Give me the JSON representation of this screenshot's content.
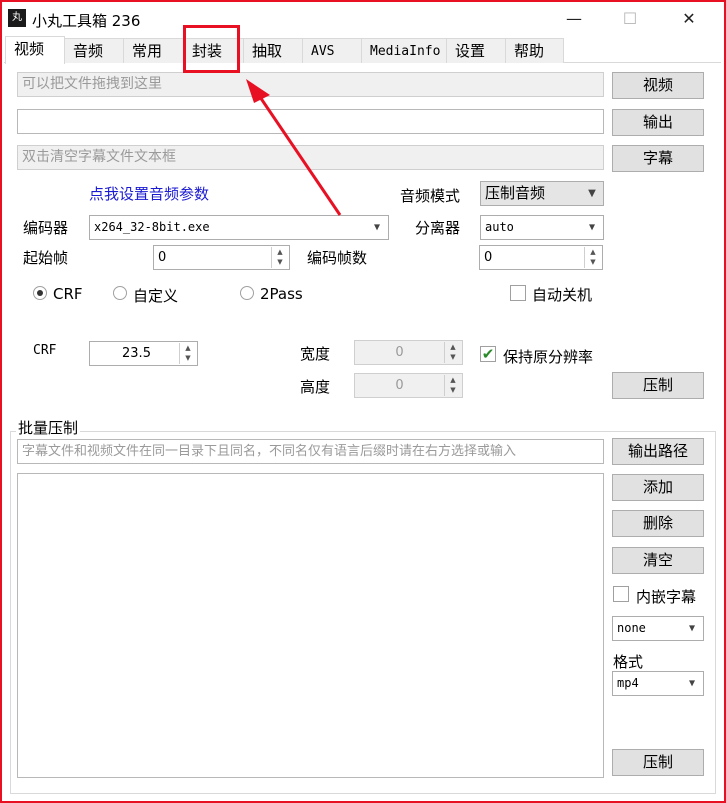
{
  "window": {
    "title": "小丸工具箱 236",
    "app_icon_text": "丸",
    "minimize": "—",
    "maximize": "☐",
    "close": "✕"
  },
  "tabs": [
    "视频",
    "音频",
    "常用",
    "封装",
    "抽取",
    "AVS",
    "MediaInfo",
    "设置",
    "帮助"
  ],
  "video": {
    "drop_placeholder": "可以把文件拖拽到这里",
    "output_value": "",
    "subtitle_placeholder": "双击清空字幕文件文本框",
    "btn_video": "视频",
    "btn_output": "输出",
    "btn_subtitle": "字幕",
    "audio_settings_link": "点我设置音频参数",
    "audio_mode_label": "音频模式",
    "audio_mode_value": "压制音频",
    "encoder_label": "编码器",
    "encoder_value": "x264_32-8bit.exe",
    "demuxer_label": "分离器",
    "demuxer_value": "auto",
    "start_frame_label": "起始帧",
    "start_frame_value": "0",
    "encode_frames_label": "编码帧数",
    "encode_frames_value": "0",
    "mode_crf": "CRF",
    "mode_custom": "自定义",
    "mode_2pass": "2Pass",
    "selected_mode": "CRF",
    "auto_shutdown_label": "自动关机",
    "auto_shutdown_checked": false,
    "crf_label": "CRF",
    "crf_value": "23.5",
    "width_label": "宽度",
    "width_value": "0",
    "height_label": "高度",
    "height_value": "0",
    "keep_res_label": "保持原分辨率",
    "keep_res_checked": true,
    "btn_encode": "压制"
  },
  "batch": {
    "group_title": "批量压制",
    "hint_placeholder": "字幕文件和视频文件在同一目录下且同名，不同名仅有语言后缀时请在右方选择或输入",
    "btn_output_path": "输出路径",
    "btn_add": "添加",
    "btn_delete": "删除",
    "btn_clear": "清空",
    "embed_sub_label": "内嵌字幕",
    "embed_sub_checked": false,
    "sub_select_value": "none",
    "format_label": "格式",
    "format_value": "mp4",
    "btn_encode": "压制"
  },
  "annotation": {
    "color": "#e81123"
  }
}
